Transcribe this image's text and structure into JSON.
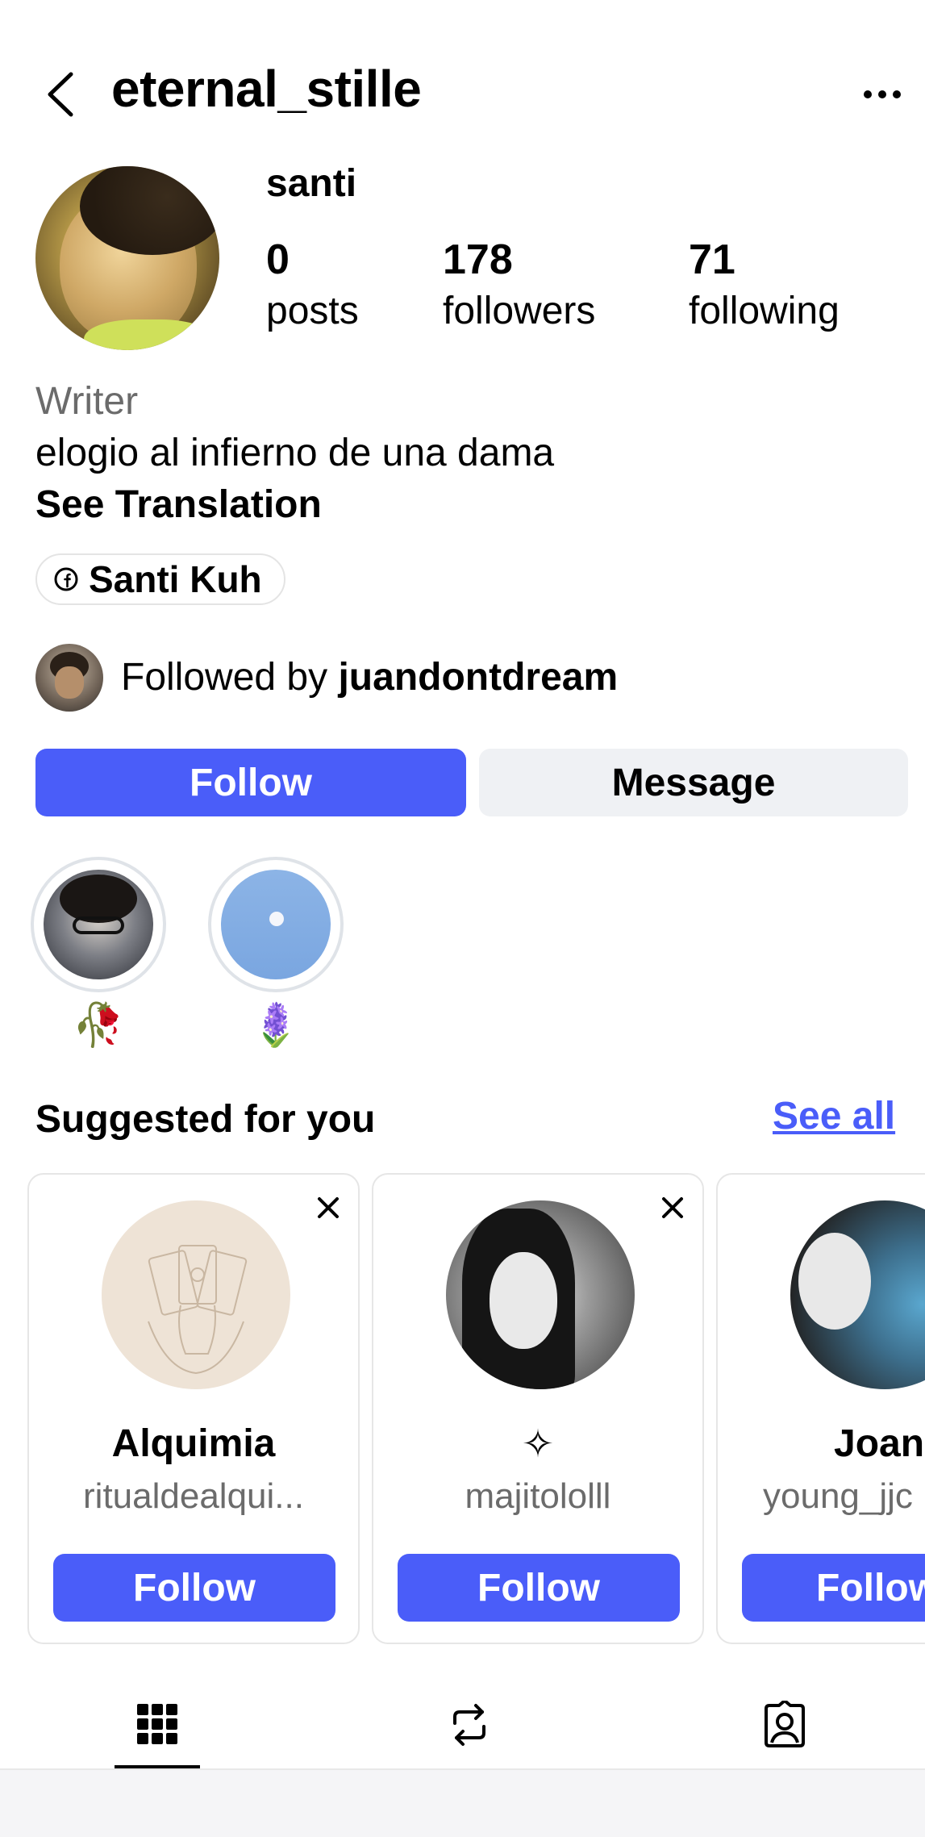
{
  "header": {
    "username": "eternal_stille",
    "icons": {
      "back": "chevron-left-icon",
      "more": "more-horizontal-icon"
    }
  },
  "profile": {
    "display_name": "santi",
    "stats": [
      {
        "value": "0",
        "label": "posts"
      },
      {
        "value": "178",
        "label": "followers"
      },
      {
        "value": "71",
        "label": "following"
      }
    ],
    "bio_category": "Writer",
    "bio_text": "elogio al infierno de una dama",
    "see_translation": "See Translation",
    "link_label": "Santi Kuh",
    "link_icon": "facebook-icon",
    "followed_by_prefix": "Followed by",
    "followed_by_user": "juandontdream"
  },
  "actions": {
    "follow_label": "Follow",
    "message_label": "Message",
    "follow_color": "#4a5df9"
  },
  "highlights": [
    {
      "label": "🥀"
    },
    {
      "label": "🪻"
    }
  ],
  "suggested": {
    "title": "Suggested for you",
    "see_all": "See all",
    "cards": [
      {
        "name": "Alquimia",
        "handle": "ritualdealqui...",
        "button": "Follow"
      },
      {
        "name": "✧",
        "handle": "majitololll",
        "button": "Follow"
      },
      {
        "name": "Joan",
        "handle": "young_jjc",
        "button": "Follow"
      }
    ]
  },
  "tabs": [
    {
      "icon": "grid-icon",
      "active": true
    },
    {
      "icon": "reposts-icon",
      "active": false
    },
    {
      "icon": "tagged-person-icon",
      "active": false
    }
  ]
}
